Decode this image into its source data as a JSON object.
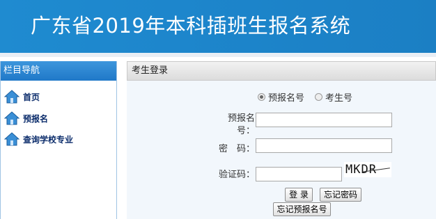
{
  "header": {
    "title": "广东省2019年本科插班生报名系统"
  },
  "sidebar": {
    "title": "栏目导航",
    "items": [
      {
        "label": "首页",
        "icon": "home-icon"
      },
      {
        "label": "预报名",
        "icon": "home-icon"
      },
      {
        "label": "查询学校专业",
        "icon": "home-icon"
      }
    ]
  },
  "login": {
    "title": "考生登录",
    "radio_options": [
      {
        "label": "预报名号",
        "checked": true
      },
      {
        "label": "考生号",
        "checked": false
      }
    ],
    "fields": {
      "prereg_label": "预报名号：",
      "password_label": "密　码：",
      "captcha_label": "验证码："
    },
    "captcha_text": "MKDR",
    "buttons": {
      "login": "登 录",
      "forgot_password": "忘记密码",
      "forgot_prereg": "忘记预报名号"
    }
  },
  "colors": {
    "header_blue": "#1f86cc",
    "nav_text": "#0b2c6b"
  }
}
